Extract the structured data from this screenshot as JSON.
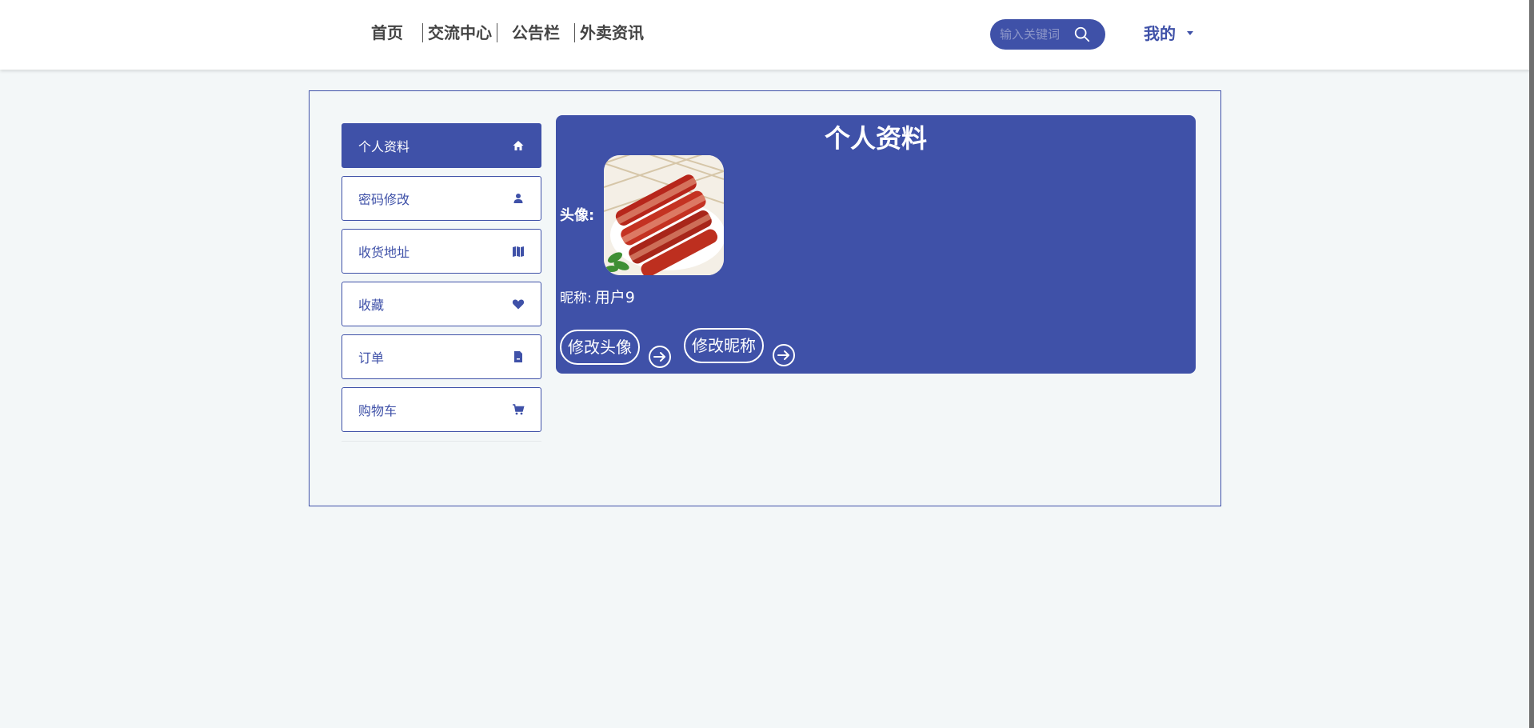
{
  "nav": {
    "items": [
      {
        "label": "首页"
      },
      {
        "label": "交流中心"
      },
      {
        "label": "公告栏"
      },
      {
        "label": "外卖资讯"
      }
    ],
    "search_placeholder": "输入关键词",
    "user_menu_label": "我的"
  },
  "sidebar": {
    "items": [
      {
        "label": "个人资料",
        "icon": "home-icon",
        "active": true
      },
      {
        "label": "密码修改",
        "icon": "user-icon"
      },
      {
        "label": "收货地址",
        "icon": "map-icon"
      },
      {
        "label": "收藏",
        "icon": "heart-icon"
      },
      {
        "label": "订单",
        "icon": "document-icon"
      },
      {
        "label": "购物车",
        "icon": "cart-icon"
      }
    ]
  },
  "profile": {
    "title": "个人资料",
    "avatar_label": "头像:",
    "nickname_label": "昵称:",
    "nickname_value": "用户9",
    "change_avatar_button": "修改头像",
    "change_nickname_button": "修改昵称"
  },
  "colors": {
    "accent": "#3f51a8",
    "background": "#f3f7f8",
    "white": "#ffffff"
  }
}
